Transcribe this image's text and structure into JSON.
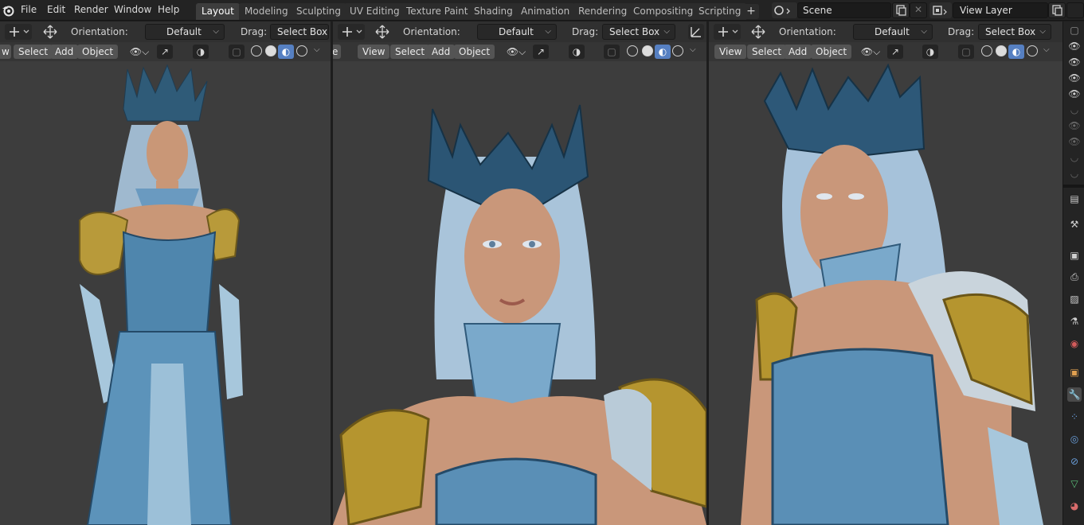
{
  "menu": [
    "File",
    "Edit",
    "Render",
    "Window",
    "Help"
  ],
  "workspace_tabs": [
    {
      "label": "Layout",
      "active": true
    },
    {
      "label": "Modeling",
      "active": false
    },
    {
      "label": "Sculpting",
      "active": false
    },
    {
      "label": "UV Editing",
      "active": false
    },
    {
      "label": "Texture Paint",
      "active": false
    },
    {
      "label": "Shading",
      "active": false
    },
    {
      "label": "Animation",
      "active": false
    },
    {
      "label": "Rendering",
      "active": false
    },
    {
      "label": "Compositing",
      "active": false
    },
    {
      "label": "Scripting",
      "active": false
    }
  ],
  "add_workspace": "+",
  "scene": {
    "value": "Scene"
  },
  "view_layer": {
    "value": "View Layer"
  },
  "viewports": [
    {
      "orientation_label": "Orientation:",
      "orientation_value": "Default",
      "drag_label": "Drag:",
      "drag_value": "Select Box",
      "menu": [
        "w",
        "Select",
        "Add",
        "Object"
      ]
    },
    {
      "orientation_label": "Orientation:",
      "orientation_value": "Default",
      "drag_label": "Drag:",
      "drag_value": "Select Box",
      "menu": [
        "e",
        "View",
        "Select",
        "Add",
        "Object"
      ]
    },
    {
      "orientation_label": "Orientation:",
      "orientation_value": "Default",
      "drag_label": "Drag:",
      "drag_value": "Select Box",
      "menu": [
        "View",
        "Select",
        "Add",
        "Object"
      ]
    }
  ],
  "icons": {
    "blender_logo": "blender-logo-icon",
    "transform": "transform-icon",
    "move": "move-icon",
    "visibility": "eye-icon",
    "gizmo": "gizmo-icon",
    "overlay": "overlay-icon",
    "xray": "xray-icon",
    "wireframe": "wireframe-icon",
    "solid": "solid-shading-icon",
    "material": "material-preview-icon",
    "rendered": "rendered-shading-icon"
  },
  "colors": {
    "accent": "#5680c2",
    "viewport_bg": "#3d3d3d",
    "header_bg": "#303030"
  }
}
